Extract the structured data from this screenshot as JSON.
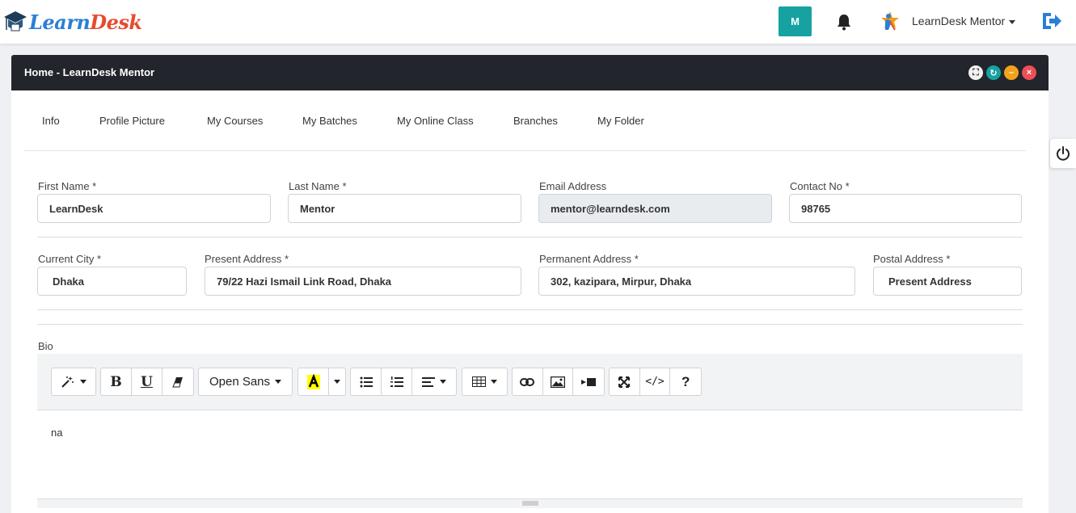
{
  "brand": {
    "learn": "Learn",
    "desk": "Desk"
  },
  "navbar": {
    "avatar_letter": "M",
    "user_name": "LearnDesk Mentor",
    "accent": "#17a2a2"
  },
  "panel": {
    "title": "Home - LearnDesk Mentor",
    "window_controls": [
      "expand-icon",
      "refresh-icon",
      "minimize-icon",
      "close-icon"
    ]
  },
  "tabs": [
    "Info",
    "Profile Picture",
    "My Courses",
    "My Batches",
    "My Online Class",
    "Branches",
    "My Folder"
  ],
  "form": {
    "first_name": {
      "label": "First Name *",
      "value": "LearnDesk"
    },
    "last_name": {
      "label": "Last Name *",
      "value": "Mentor"
    },
    "email": {
      "label": "Email Address",
      "value": "mentor@learndesk.com"
    },
    "contact": {
      "label": "Contact No *",
      "value": "98765"
    },
    "city": {
      "label": "Current City *",
      "value": "Dhaka"
    },
    "present_address": {
      "label": "Present Address *",
      "value": "79/22 Hazi Ismail Link Road, Dhaka"
    },
    "permanent_address": {
      "label": "Permanent Address *",
      "value": "302, kazipara, Mirpur, Dhaka"
    },
    "postal_address": {
      "label": "Postal Address *",
      "value": "Present Address"
    },
    "bio": {
      "label": "Bio",
      "value": "na"
    }
  },
  "editor": {
    "font_name": "Open Sans",
    "bold": "B",
    "underline": "U",
    "help": "?",
    "code": "</>"
  }
}
